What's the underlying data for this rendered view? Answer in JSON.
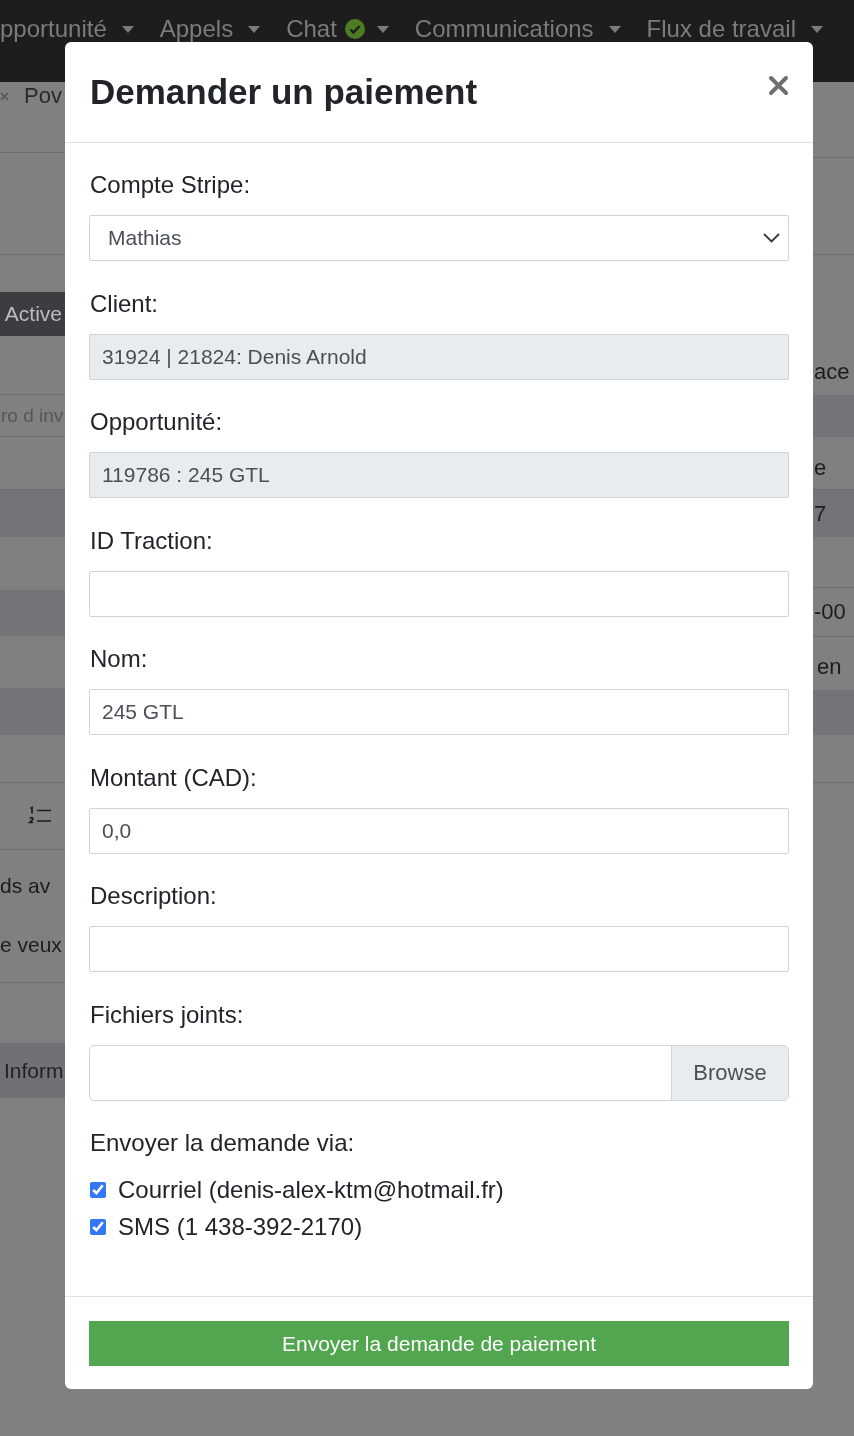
{
  "nav": {
    "items": [
      {
        "label": "pportunité",
        "kind": "dropdown",
        "status_ok": false
      },
      {
        "label": "Appels",
        "kind": "dropdown",
        "status_ok": false
      },
      {
        "label": "Chat",
        "kind": "dropdown",
        "status_ok": true
      },
      {
        "label": "Communications",
        "kind": "dropdown",
        "status_ok": false
      },
      {
        "label": "Flux de travail",
        "kind": "dropdown",
        "status_ok": false
      }
    ]
  },
  "page_left": {
    "title": "Pov",
    "badge": "Active",
    "filter_placeholder": "ro d inv",
    "text_lines": [
      "ds av",
      "e veux"
    ],
    "section": "Inform"
  },
  "page_right": {
    "cells": [
      "ace",
      "e",
      "7",
      "-00",
      "en"
    ]
  },
  "dialog": {
    "title": "Demander un paiement",
    "fields": [
      {
        "label": "Compte Stripe:",
        "kind": "select",
        "value": "Mathias"
      },
      {
        "label": "Client:",
        "kind": "readonly",
        "value": "31924 | 21824: Denis Arnold"
      },
      {
        "label": "Opportunité:",
        "kind": "readonly",
        "value": "119786 : 245 GTL"
      },
      {
        "label": "ID Traction:",
        "kind": "text"
      },
      {
        "label": "Nom:",
        "kind": "text",
        "value": "245 GTL"
      },
      {
        "label": "Montant (CAD):",
        "kind": "text",
        "value": "0,0"
      },
      {
        "label": "Description:",
        "kind": "text"
      },
      {
        "label": "Fichiers joints:",
        "kind": "file",
        "button": "Browse"
      }
    ],
    "send_via": {
      "label": "Envoyer la demande via:",
      "options": [
        {
          "label": "Courriel (denis-alex-ktm@hotmail.fr)",
          "checked": true
        },
        {
          "label": "SMS (1 438-392-2170)",
          "checked": true
        }
      ]
    },
    "submit": "Envoyer la demande de paiement"
  }
}
